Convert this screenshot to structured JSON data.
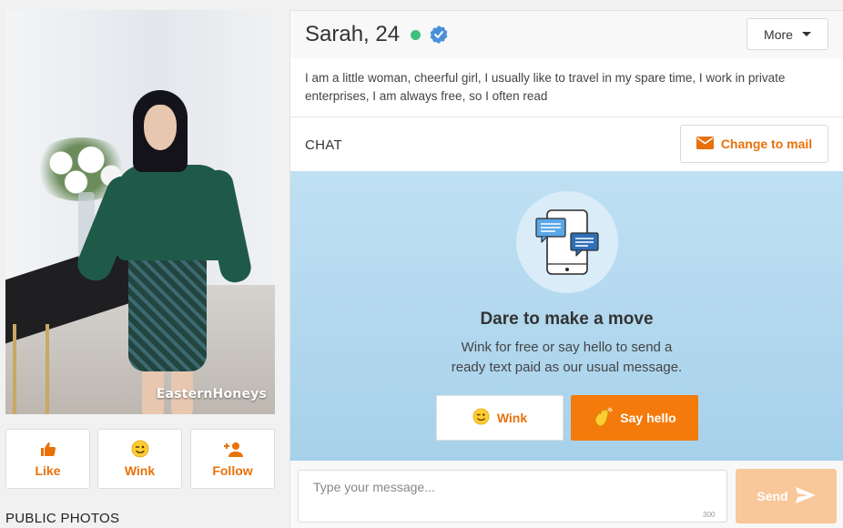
{
  "profile": {
    "photo_watermark": "EasternHoneys",
    "actions": {
      "like": "Like",
      "wink": "Wink",
      "follow": "Follow"
    },
    "public_photos_label": "PUBLIC PHOTOS",
    "name_age": "Sarah, 24",
    "online": true,
    "verified": true,
    "more_label": "More",
    "bio": "I am a little woman, cheerful girl, I usually like to travel in my spare time, I work in private enterprises, I am always free, so I often read"
  },
  "chat": {
    "label": "CHAT",
    "change_to_mail_label": "Change to mail",
    "cta_title": "Dare to make a move",
    "cta_text_line1": "Wink for free or say hello to send a",
    "cta_text_line2": "ready text paid as our usual message.",
    "wink_label": "Wink",
    "say_hello_label": "Say hello",
    "message_placeholder": "Type your message...",
    "char_limit": "300",
    "send_label": "Send"
  },
  "colors": {
    "accent": "#e8710a",
    "accent_button": "#f47b0b",
    "send_disabled": "#f8c79a",
    "online": "#3fc07a",
    "verified": "#4a90d9",
    "chat_bg": "#bfe0f3"
  },
  "icons": {
    "like": "thumbs-up-icon",
    "wink": "wink-emoji-icon",
    "follow": "add-user-icon",
    "verified": "verified-badge-icon",
    "more": "caret-down-icon",
    "mail": "envelope-icon",
    "chat_illustration": "phone-chat-icon",
    "say_hello": "waving-hand-icon",
    "send": "paper-plane-icon"
  }
}
